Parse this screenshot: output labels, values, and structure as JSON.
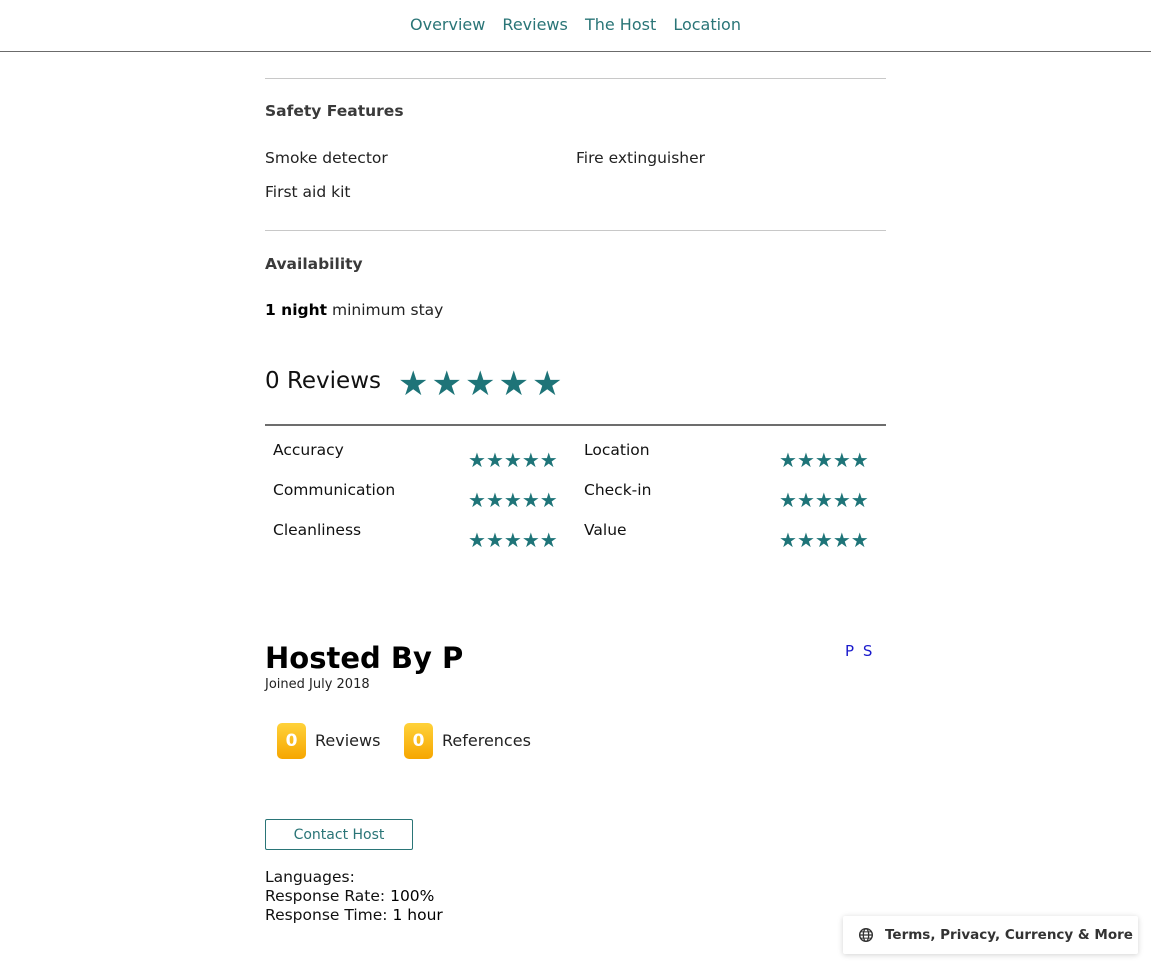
{
  "nav": {
    "links": [
      "Overview",
      "Reviews",
      "The Host",
      "Location"
    ]
  },
  "safety": {
    "title": "Safety Features",
    "items": [
      "Smoke detector",
      "Fire extinguisher",
      "First aid kit"
    ]
  },
  "availability": {
    "title": "Availability",
    "min_nights": "1 night",
    "suffix": " minimum stay"
  },
  "reviews": {
    "count_label": "0 Reviews",
    "overall_stars": 5,
    "categories": [
      {
        "name": "Accuracy",
        "stars": 5
      },
      {
        "name": "Location",
        "stars": 5
      },
      {
        "name": "Communication",
        "stars": 5
      },
      {
        "name": "Check-in",
        "stars": 5
      },
      {
        "name": "Cleanliness",
        "stars": 5
      },
      {
        "name": "Value",
        "stars": 5
      }
    ]
  },
  "host": {
    "title": "Hosted By P",
    "joined": "Joined July 2018",
    "avatar_initials": "P S",
    "stats": [
      {
        "count": "0",
        "label": "Reviews"
      },
      {
        "count": "0",
        "label": "References"
      }
    ],
    "contact_label": "Contact Host",
    "languages_label": "Languages:",
    "response_rate_label": "Response Rate:",
    "response_rate_value": "100%",
    "response_time_label": "Response Time:",
    "response_time_value": "1 hour"
  },
  "footer": {
    "label": "Terms, Privacy, Currency & More",
    "icon": "globe-icon"
  },
  "colors": {
    "accent": "#2a7577",
    "star": "#1e7478",
    "badge": "#f6a600",
    "initials": "#1a1acc"
  }
}
